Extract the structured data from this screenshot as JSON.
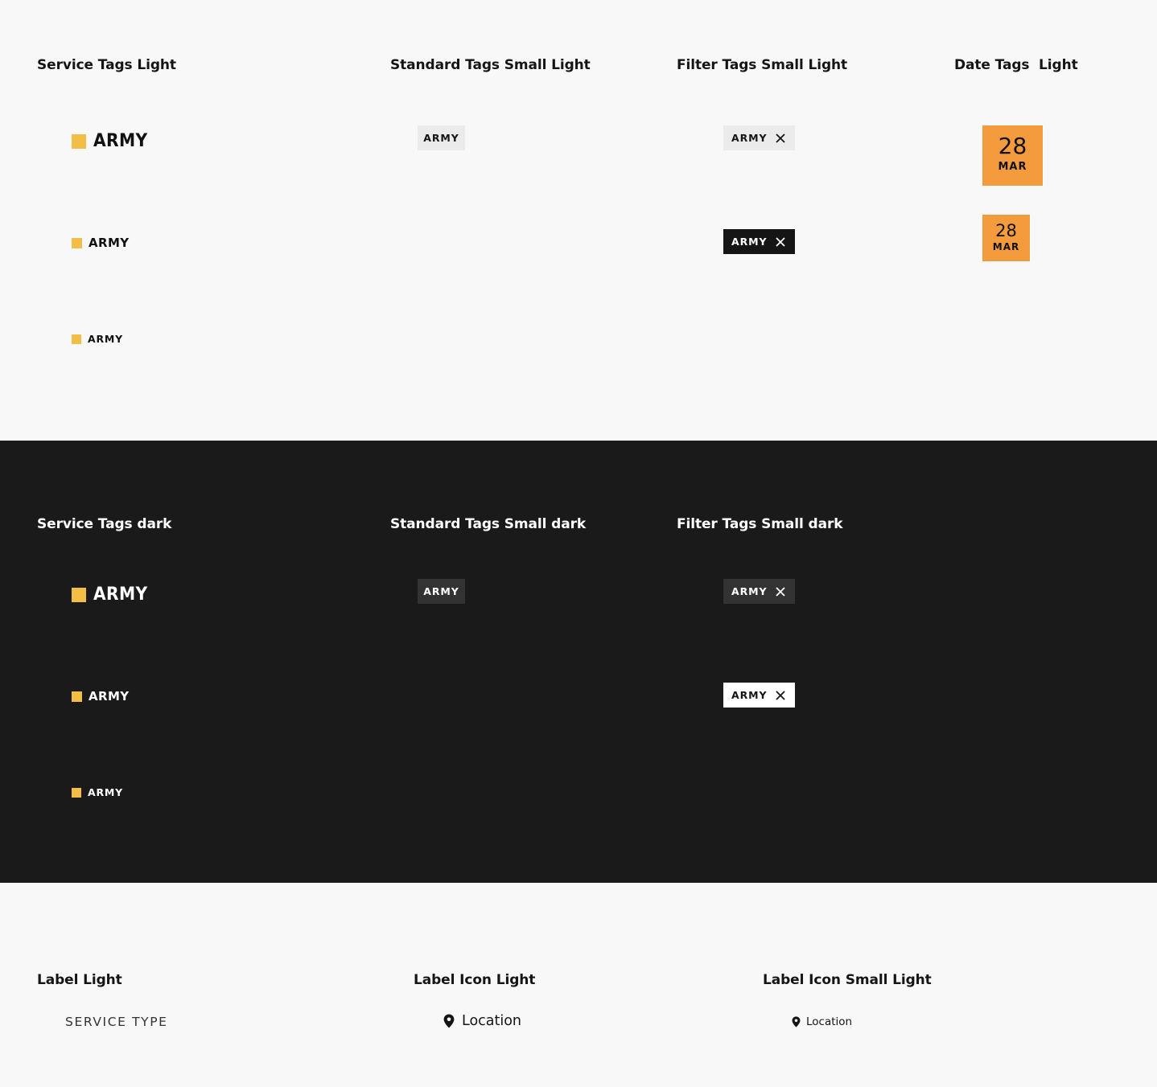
{
  "light_section": {
    "service_heading": "Service Tags Light",
    "standard_heading": "Standard Tags Small Light",
    "filter_heading": "Filter Tags Small Light",
    "date_heading": "Date Tags  Light",
    "service_tags": {
      "large": "ARMY",
      "medium": "ARMY",
      "small": "ARMY"
    },
    "standard_tag": "ARMY",
    "filter_tags": {
      "default": "ARMY",
      "selected": "ARMY"
    },
    "date_tags": {
      "large": {
        "day": "28",
        "month": "MAR"
      },
      "small": {
        "day": "28",
        "month": "MAR"
      }
    }
  },
  "dark_section": {
    "service_heading": "Service Tags dark",
    "standard_heading": "Standard Tags Small dark",
    "filter_heading": "Filter Tags Small dark",
    "service_tags": {
      "large": "ARMY",
      "medium": "ARMY",
      "small": "ARMY"
    },
    "standard_tag": "ARMY",
    "filter_tags": {
      "default": "ARMY",
      "selected": "ARMY"
    }
  },
  "labels_section": {
    "label_heading": "Label Light",
    "label_icon_heading": "Label Icon Light",
    "label_icon_small_heading": "Label Icon Small Light",
    "label_text": "SERVICE TYPE",
    "location_text": "Location",
    "location_small_text": "Location",
    "location_icon": "map-pin-icon"
  },
  "colors": {
    "service_square": "#f2be45",
    "date_background": "#f39b3d",
    "dark_background": "#1a1a1a",
    "light_background": "#f8f8f8"
  }
}
